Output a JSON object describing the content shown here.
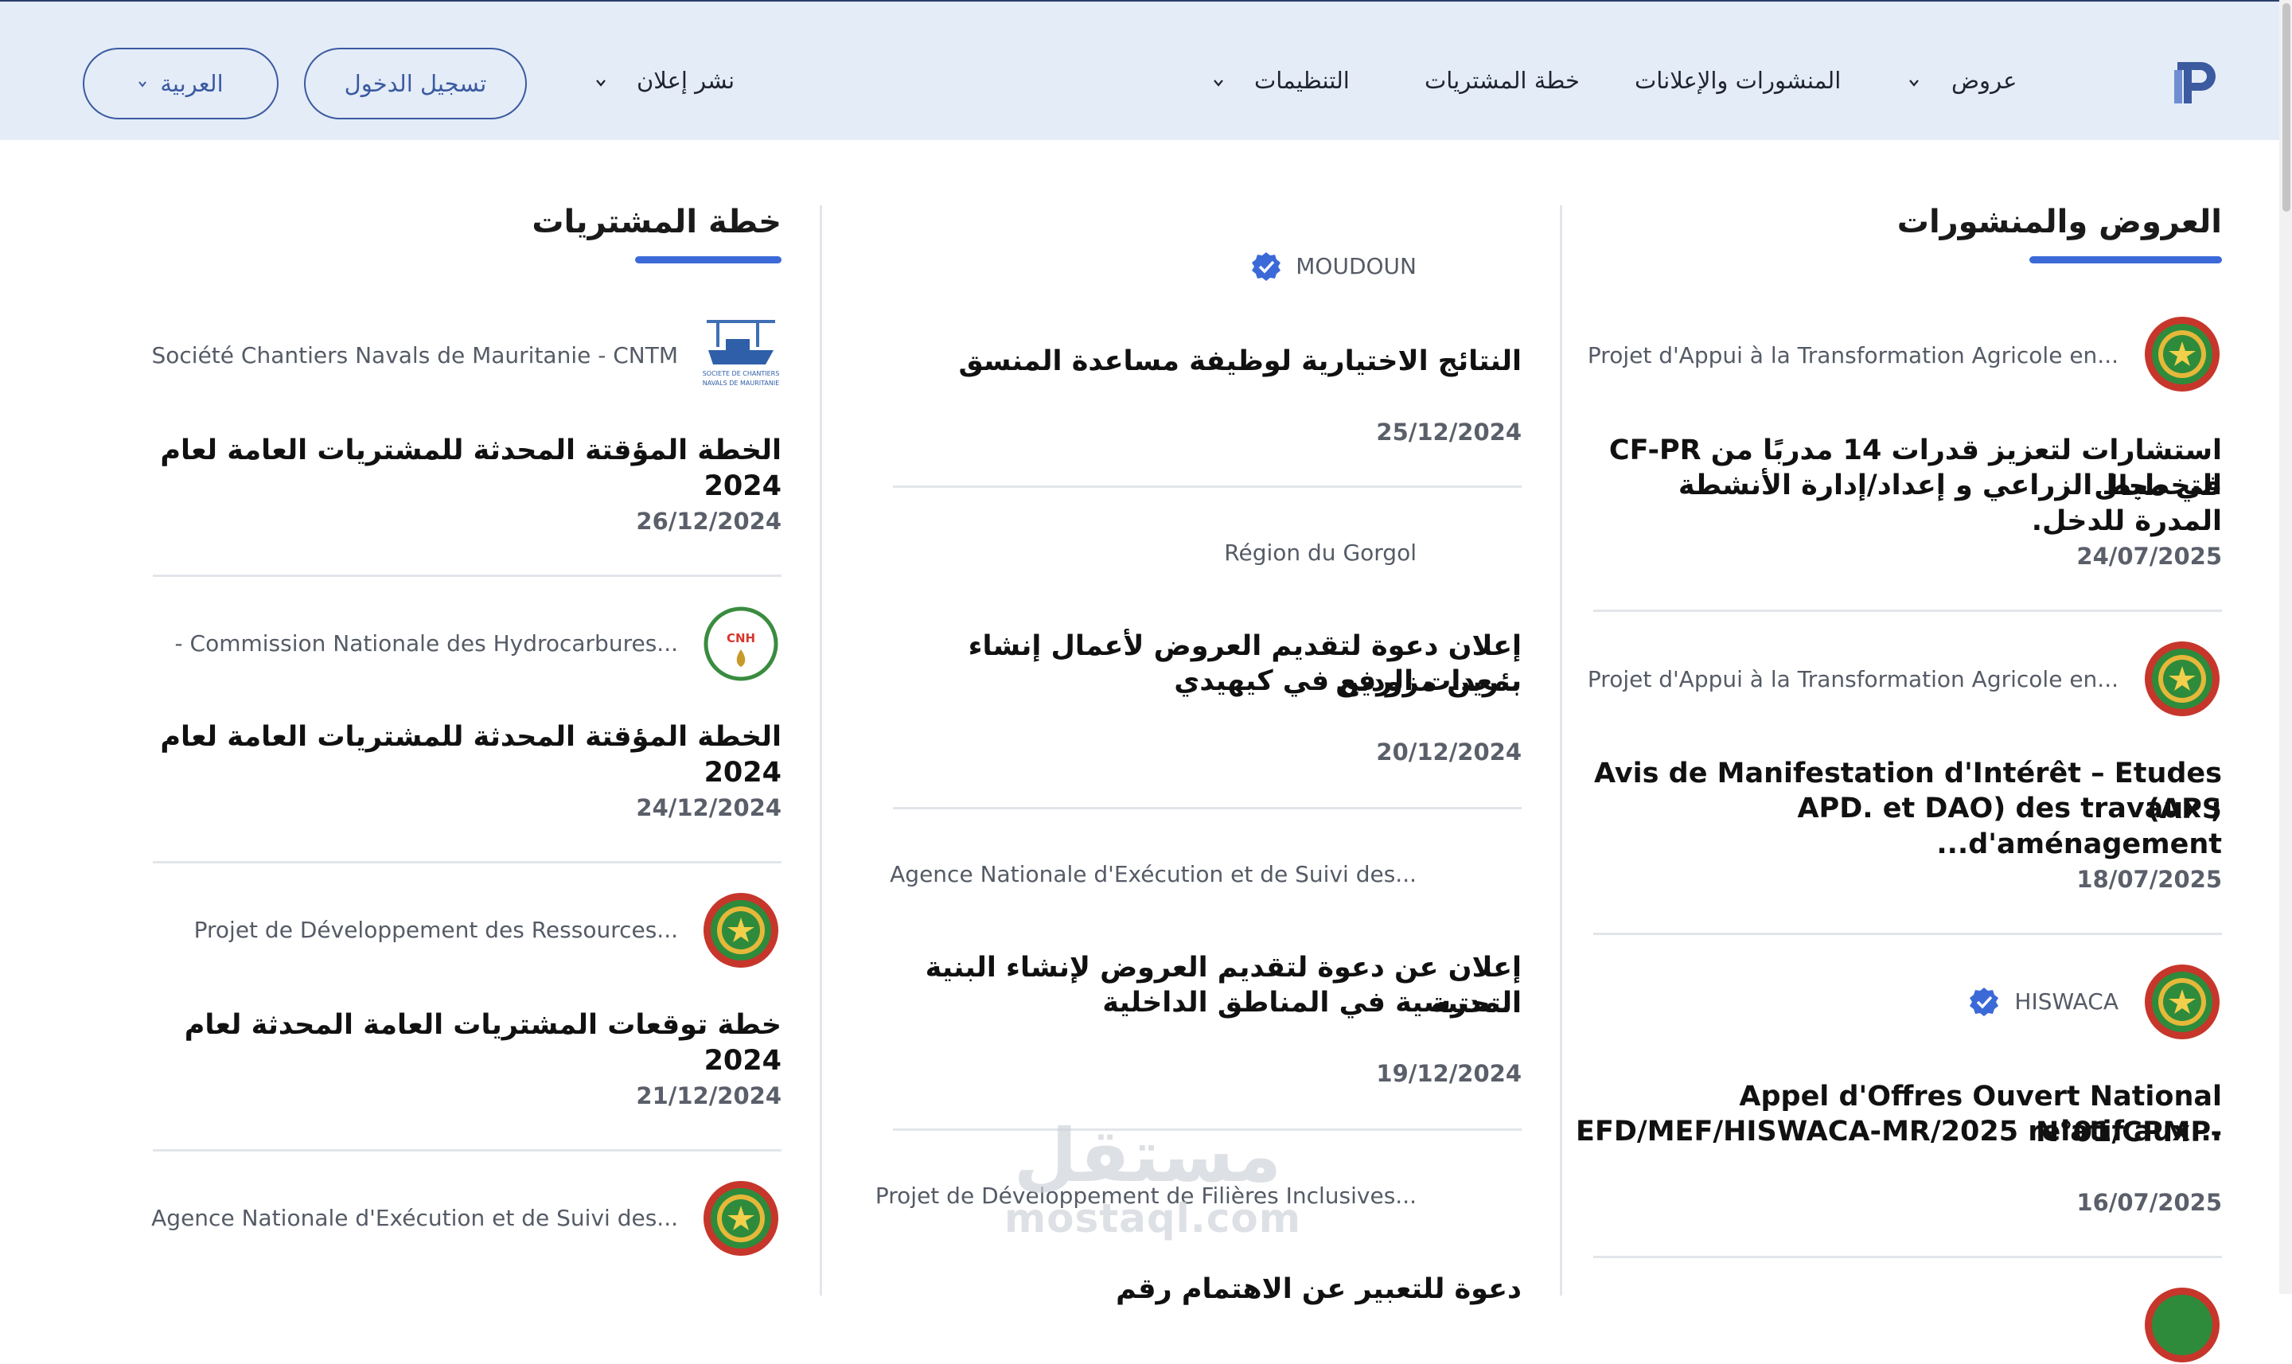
{
  "header": {
    "nav": {
      "offers": "عروض",
      "publications": "المنشورات والإعلانات",
      "procurement_plan": "خطة المشتريات",
      "organizations": "التنظيمات",
      "publish_ad": "نشر إعلان"
    },
    "login_label": "تسجيل الدخول",
    "language_label": "العربية",
    "accent_color": "#3b5aa0"
  },
  "columns": {
    "offers": {
      "title": "العروض والمنشورات",
      "items": [
        {
          "org": "Projet d'Appui à la Transformation Agricole en...",
          "title_line1": "استشارات لتعزيز قدرات 14 مدربًا من CF-PR في مجال",
          "title_line2": "التخطيط الزراعي و إعداد/إدارة الأنشطة المدرة للدخل.",
          "date": "24/07/2025",
          "logo": "mauritania-seal-icon"
        },
        {
          "org": "Projet d'Appui à la Transformation Agricole en...",
          "title_line1": "Avis de Manifestation d'Intérêt – Etudes (APS",
          "title_line2": "; APD. et DAO) des travaux d'aménagement...",
          "date": "18/07/2025",
          "logo": "mauritania-seal-icon"
        },
        {
          "org": "HISWACA",
          "verified": true,
          "title_line1": "Appel d'Offres Ouvert National N°01/CPMP-",
          "title_line2": "EFD/MEF/HISWACA-MR/2025 relatif aux...",
          "date": "16/07/2025",
          "logo": "mauritania-seal-icon"
        }
      ]
    },
    "middle": {
      "items": [
        {
          "org": "MOUDOUN",
          "verified": true,
          "title_line1": "النتائج الاختيارية لوظيفة مساعدة المنسق",
          "date": "25/12/2024"
        },
        {
          "org": "Région du Gorgol",
          "title_line1": "إعلان دعوة لتقديم العروض لأعمال إنشاء بئرين مزودين",
          "title_line2": "بمعدات الرفع في كيهيدي",
          "date": "20/12/2024"
        },
        {
          "org": "Agence Nationale d'Exécution et de Suivi des...",
          "title_line1": "إعلان عن دعوة لتقديم العروض لإنشاء البنية التحتية",
          "title_line2": "المدرسية في المناطق الداخلية",
          "date": "19/12/2024"
        },
        {
          "org": "Projet de Développement de Filières Inclusives...",
          "title_line1": "دعوة للتعبير عن الاهتمام رقم",
          "date": ""
        }
      ]
    },
    "procurement": {
      "title": "خطة المشتريات",
      "items": [
        {
          "org": "Société Chantiers Navals de Mauritanie - CNTM",
          "title": "الخطة المؤقتة المحدثة للمشتريات العامة لعام 2024",
          "date": "26/12/2024",
          "logo": "ship-yard-logo-icon",
          "logo_text": "SOCIETE DE CHANTIERS NAVALS DE MAURITANIE"
        },
        {
          "org": "- Commission Nationale des Hydrocarbures...",
          "title": "الخطة المؤقتة المحدثة للمشتريات العامة لعام 2024",
          "date": "24/12/2024",
          "logo": "cnh-logo-icon",
          "logo_text": "CNH"
        },
        {
          "org": "Projet de Développement des Ressources...",
          "title": "خطة توقعات المشتريات العامة المحدثة لعام 2024",
          "date": "21/12/2024",
          "logo": "mauritania-seal-icon"
        },
        {
          "org": "Agence Nationale d'Exécution et de Suivi des...",
          "logo": "mauritania-seal-icon"
        }
      ]
    }
  },
  "watermark": {
    "arabic": "مستقل",
    "latin": "mostaql.com"
  }
}
